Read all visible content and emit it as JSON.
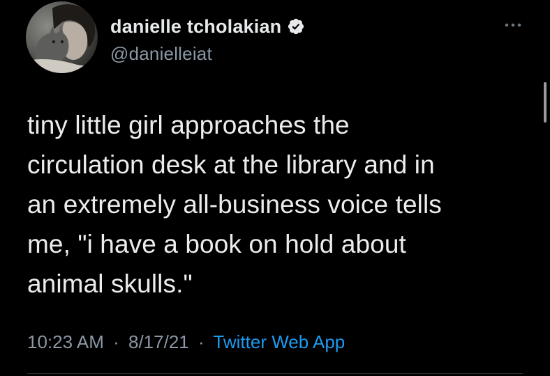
{
  "tweet": {
    "author": {
      "display_name": "danielle tcholakian",
      "handle": "@danielleiat",
      "verified": true,
      "avatar_icon": "profile-photo-with-cat"
    },
    "more_icon": "more-options-icon",
    "text": "tiny little girl approaches the\ncirculation desk at the library and in\nan extremely all-business voice tells\nme, \"i have a book on hold about\nanimal skulls.\"",
    "time": "10:23 AM",
    "separator": "·",
    "date": "8/17/21",
    "source": "Twitter Web App"
  },
  "colors": {
    "background": "#000000",
    "text": "#e7e9ea",
    "secondary_text": "#8b98a5",
    "accent": "#1d9bf0"
  }
}
